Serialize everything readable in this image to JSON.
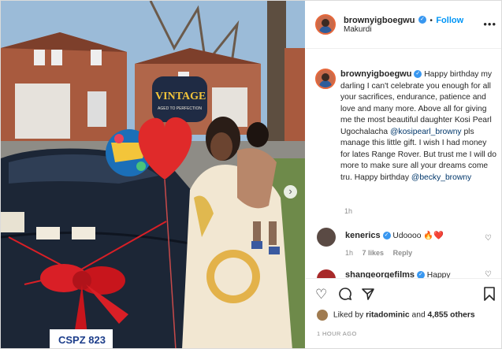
{
  "header": {
    "username": "brownyigboegwu",
    "follow_label": "Follow",
    "location": "Makurdi",
    "more_label": "•••"
  },
  "caption": {
    "username": "brownyigboegwu",
    "text_1": "Happy birthday my darling I can't celebrate you enough for all your sacrifices, endurance, patience and love and many more. Above all for giving me the most beautiful daughter Kosi Pearl Ugochalacha",
    "mention_1": "@kosipearl_browny",
    "text_2": "pls manage this little gift. I wish I had money for lates Range Rover. But trust me I will do more to make sure all your dreams come tru. Happy birthday",
    "mention_2": "@becky_browny",
    "time": "1h"
  },
  "comments": [
    {
      "username": "kenerics",
      "text": "Udoooo 🔥❤️",
      "time": "1h",
      "likes": "7 likes",
      "reply_label": "Reply"
    },
    {
      "username": "shangeorgefilms",
      "text": "Happy"
    }
  ],
  "actions": {
    "liked_by_prefix": "Liked by",
    "liked_by_user": "ritadominic",
    "liked_by_and": "and",
    "liked_by_count": "4,855 others",
    "time_ago": "1 HOUR AGO"
  },
  "photo": {
    "balloon_text": "VINTAGE",
    "balloon_sub": "AGED TO PERFECTION",
    "plate": "CSPZ 823",
    "colors": {
      "sky": "#9bbbd8",
      "car": "#1c2636",
      "dress": "#f2e7d2",
      "bow": "#d91f26",
      "heart_balloon": "#e02a2a",
      "brick": "#a85a3e"
    }
  },
  "colors": {
    "accent": "#0095f6",
    "verified": "#3897f0",
    "muted": "#8e8e8e",
    "text": "#262626"
  }
}
